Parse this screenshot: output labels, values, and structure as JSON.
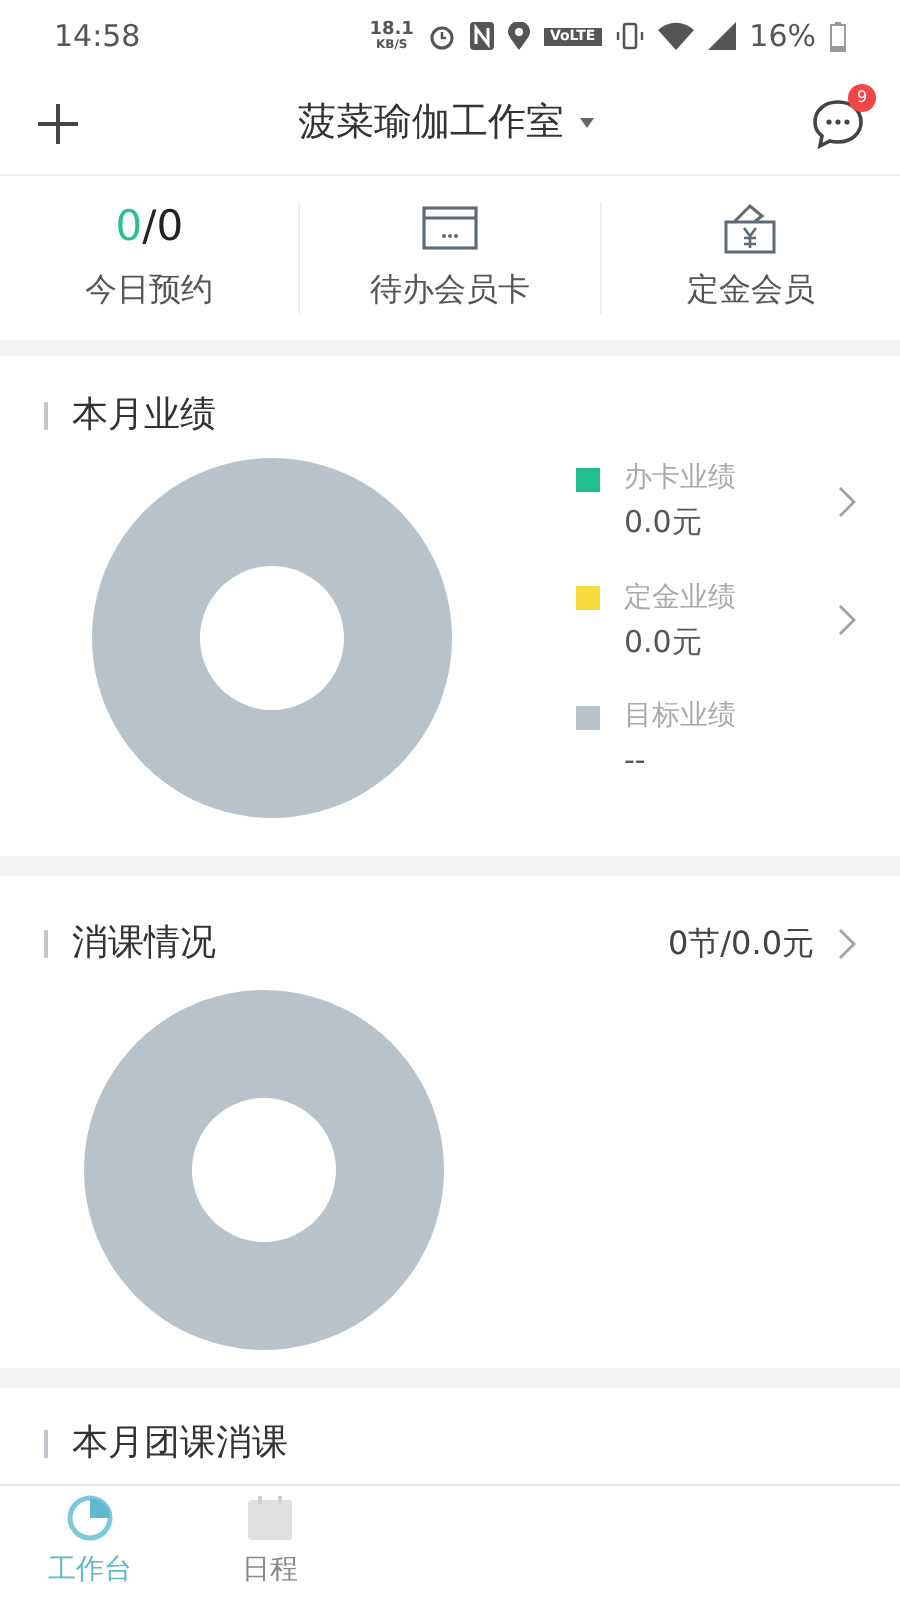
{
  "status_bar": {
    "time": "14:58",
    "speed": "18.1",
    "speed_unit": "KB/S",
    "network_badge": "VoLTE",
    "battery": "16%"
  },
  "header": {
    "title": "菠菜瑜伽工作室",
    "badge": "9"
  },
  "quick_actions": [
    {
      "kind": "count",
      "done": "0",
      "separator": "/",
      "total": "0",
      "label": "今日预约"
    },
    {
      "kind": "card",
      "label": "待办会员卡"
    },
    {
      "kind": "deposit",
      "label": "定金会员"
    }
  ],
  "performance": {
    "title": "本月业绩",
    "legend": [
      {
        "label": "办卡业绩",
        "value": "0.0元",
        "color": "#1fbf8f",
        "has_link": true
      },
      {
        "label": "定金业绩",
        "value": "0.0元",
        "color": "#f5dc3c",
        "has_link": true
      },
      {
        "label": "目标业绩",
        "value": "--",
        "color": "#b8c2c8",
        "has_link": false
      }
    ]
  },
  "classes": {
    "title": "消课情况",
    "summary": "0节/0.0元"
  },
  "group_classes": {
    "title": "本月团课消课"
  },
  "tab_bar": [
    {
      "label": "工作台",
      "selected": true
    },
    {
      "label": "日程",
      "selected": false
    }
  ]
}
